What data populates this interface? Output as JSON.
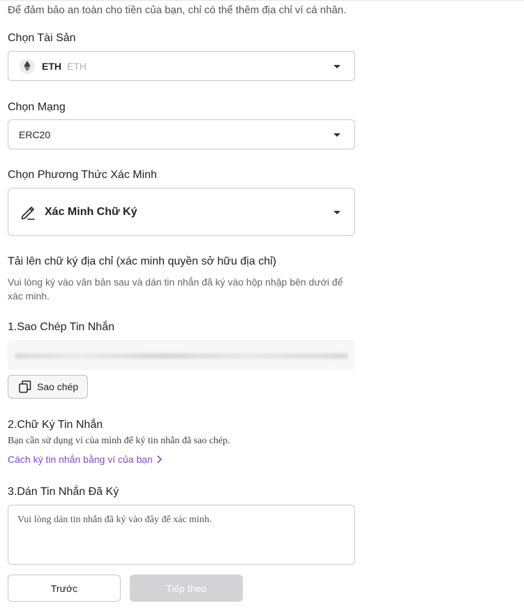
{
  "intro_text": "Để đảm bảo an toàn cho tiền của bạn, chỉ có thể thêm địa chỉ ví cá nhân.",
  "asset": {
    "label": "Chọn Tài Sản",
    "selected_main": "ETH",
    "selected_sub": "ETH",
    "icon": "ethereum-icon"
  },
  "network": {
    "label": "Chọn Mạng",
    "selected": "ERC20"
  },
  "verify_method": {
    "label": "Chọn Phương Thức Xác Minh",
    "selected": "Xác Minh Chữ Ký",
    "icon": "pen-icon"
  },
  "upload_section": {
    "title": "Tải lên chữ ký địa chỉ (xác minh quyền sở hữu địa chỉ)",
    "description": "Vui lòng ký vào văn bản sau và dán tin nhắn đã ký vào hộp nhập bên dưới để xác minh."
  },
  "step1": {
    "title": "1.Sao Chép Tin Nhắn",
    "copy_button": "Sao chép"
  },
  "step2": {
    "title": "2.Chữ Ký Tin Nhắn",
    "description": "Bạn cần sử dụng ví của mình để ký tin nhắn đã sao chép.",
    "link": "Cách ký tin nhắn bằng ví của bạn"
  },
  "step3": {
    "title": "3.Dán Tin Nhắn Đã Ký",
    "placeholder": "Vui lòng dán tin nhắn đã ký vào đây để xác minh."
  },
  "buttons": {
    "prev": "Trước",
    "next": "Tiếp theo"
  },
  "colors": {
    "link": "#7b4fc9",
    "disabled_button": "#d3d3d5",
    "border": "#c8c8c8"
  }
}
